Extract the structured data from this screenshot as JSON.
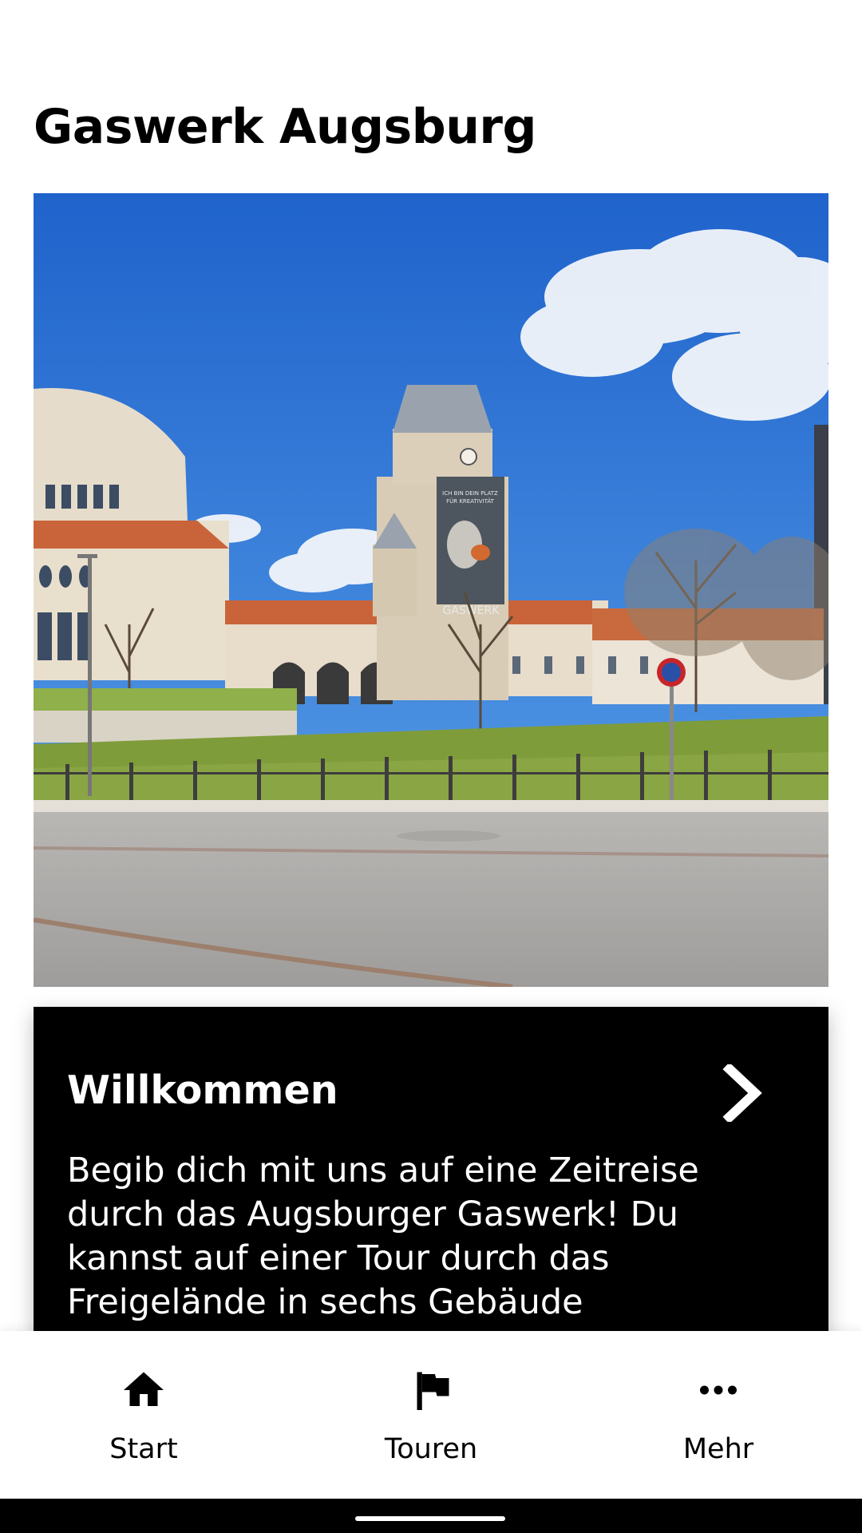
{
  "page": {
    "title": "Gaswerk Augsburg"
  },
  "hero_image": {
    "description": "Gaswerk Augsburg building with clock tower under blue sky",
    "tower_banner_line1": "ICH BIN DEIN PLATZ",
    "tower_banner_line2": "FÜR KREATIVITÄT",
    "tower_banner_word": "GASWERK"
  },
  "welcome_card": {
    "title": "Willkommen",
    "body": "Begib dich mit uns auf eine Zeitreise durch das Augsburger Gaswerk! Du kannst auf einer Tour durch das Freigelände in sechs Gebäude hineinblicken. In den …",
    "chevron_icon": "chevron-right-icon"
  },
  "bottom_nav": {
    "items": [
      {
        "label": "Start",
        "icon": "home-icon"
      },
      {
        "label": "Touren",
        "icon": "flag-icon"
      },
      {
        "label": "Mehr",
        "icon": "more-horizontal-icon"
      }
    ]
  },
  "colors": {
    "card_background": "#000000",
    "card_text": "#ffffff",
    "nav_background": "#ffffff",
    "sky": "#2a6fd1"
  }
}
